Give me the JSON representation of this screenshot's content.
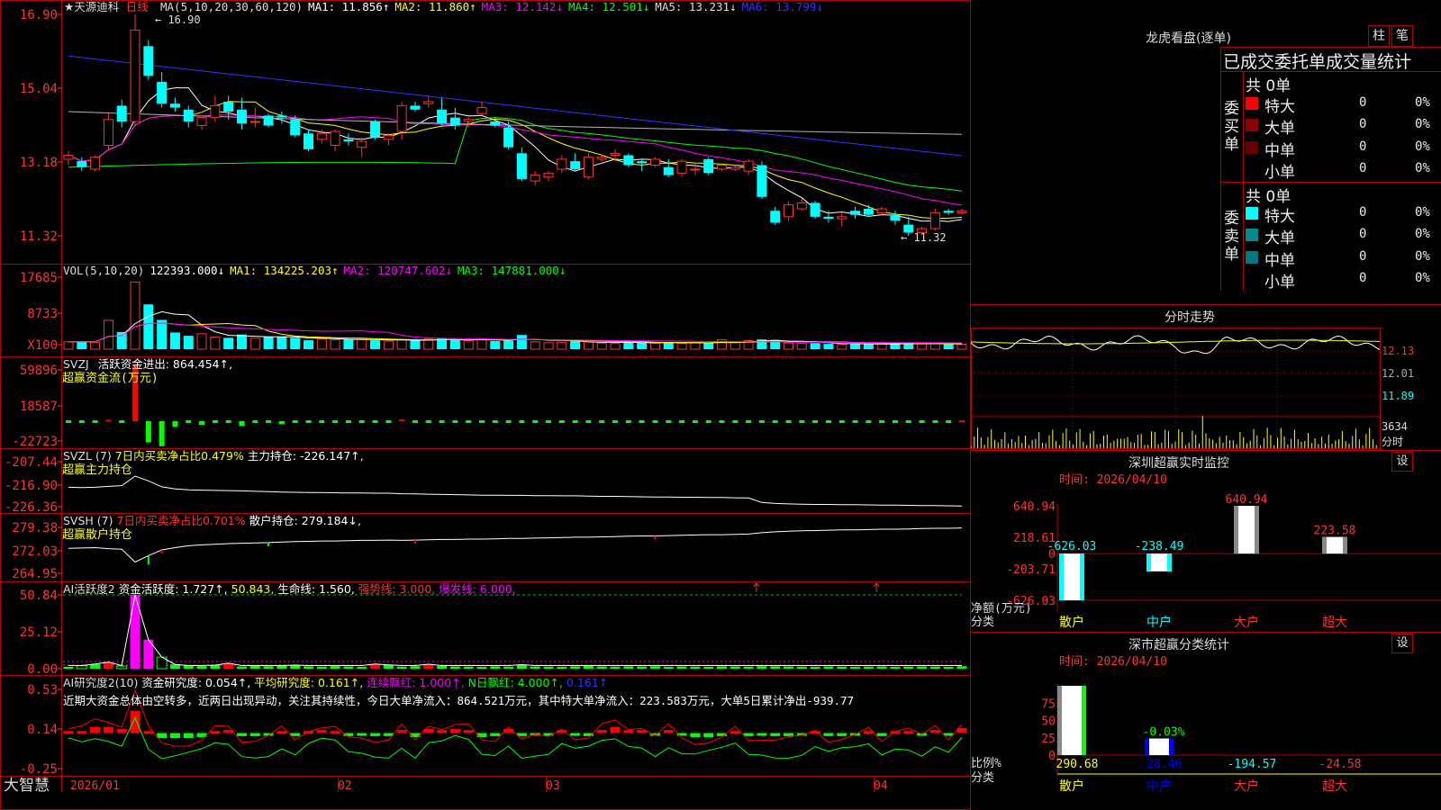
{
  "stock": {
    "name": "★天源迪科",
    "period": "日线"
  },
  "colors": {
    "up": "#ff3232",
    "down": "#00ffff",
    "ma1": "#ffffff",
    "ma2": "#ffff00",
    "ma3": "#ff00ff",
    "ma4": "#00ff00",
    "ma5": "#b4b4b4",
    "ma6": "#3232ff",
    "border": "#b40000"
  },
  "main": {
    "ma_header": [
      {
        "text": "MA(5,10,20,30,60,120)",
        "color": "#dddddd"
      },
      {
        "text": "MA1: 11.856↑",
        "color": "#ffffff"
      },
      {
        "text": "MA2: 11.860↑",
        "color": "#ffff00"
      },
      {
        "text": "MA3: 12.142↓",
        "color": "#ff00ff"
      },
      {
        "text": "MA4: 12.501↓",
        "color": "#00ff00"
      },
      {
        "text": "MA5: 13.231↓",
        "color": "#dddddd"
      },
      {
        "text": "MA6: 13.799↓",
        "color": "#3232ff"
      }
    ],
    "y_ticks": [
      "16.90",
      "15.04",
      "13.18",
      "11.32"
    ],
    "high_label": "16.90",
    "low_label": "11.32",
    "dates": [
      "2026/01",
      "02",
      "03",
      "04"
    ]
  },
  "vol": {
    "header": [
      {
        "text": "VOL(5,10,20)",
        "color": "#dddddd"
      },
      {
        "text": "122393.000↓",
        "color": "#ffffff"
      },
      {
        "text": "MA1: 134225.203↑",
        "color": "#ffff00"
      },
      {
        "text": "MA2: 120747.602↓",
        "color": "#ff00ff"
      },
      {
        "text": "MA3: 147881.000↓",
        "color": "#00ff00"
      }
    ],
    "y_ticks": [
      "17685",
      "8733",
      "X100"
    ]
  },
  "svzj": {
    "header": [
      {
        "text": "SVZJ",
        "color": "#dddddd"
      },
      {
        "text": "活跃资金进出: 864.454↑,",
        "color": "#ffffff"
      }
    ],
    "title2": "超赢资金流(万元)",
    "y_ticks": [
      "59896",
      "18587",
      "-22723"
    ]
  },
  "svzl": {
    "header": [
      {
        "text": "SVZL (7)",
        "color": "#dddddd"
      },
      {
        "text": "7日内买卖净占比0.479%",
        "color": "#ffff00"
      },
      {
        "text": "主力持仓: -226.147↑,",
        "color": "#ffffff"
      }
    ],
    "title2": "超赢主力持仓",
    "y_ticks": [
      "-207.44",
      "-216.90",
      "-226.36"
    ]
  },
  "svsh": {
    "header": [
      {
        "text": "SVSH (7)",
        "color": "#dddddd"
      },
      {
        "text": "7日内买卖净占比0.701%",
        "color": "#ff3232"
      },
      {
        "text": "散户持仓: 279.184↓,",
        "color": "#ffffff"
      }
    ],
    "title2": "超赢散户持仓",
    "y_ticks": [
      "279.38",
      "272.03",
      "264.95"
    ]
  },
  "ai1": {
    "header": [
      {
        "text": "AI活跃度2",
        "color": "#dddddd"
      },
      {
        "text": "资金活跃度: 1.727↑,",
        "color": "#ffffff"
      },
      {
        "text": "50.843,",
        "color": "#ffff00"
      },
      {
        "text": "生命线: 1.560,",
        "color": "#ffffff"
      },
      {
        "text": "强势线: 3.000,",
        "color": "#ff3232"
      },
      {
        "text": "爆发线: 6.000,",
        "color": "#ff00ff"
      }
    ],
    "y_ticks": [
      "50.84",
      "25.12",
      "0.00"
    ]
  },
  "ai2": {
    "header": [
      {
        "text": "AI研究度2(10)",
        "color": "#dddddd"
      },
      {
        "text": "资金研究度: 0.054↑,",
        "color": "#ffffff"
      },
      {
        "text": "平均研究度: 0.161↑,",
        "color": "#ffff00"
      },
      {
        "text": "连续飘红: 1.000↑,",
        "color": "#ff00ff"
      },
      {
        "text": "N日飘红: 4.000↑,",
        "color": "#00ff00"
      },
      {
        "text": "0.161↑",
        "color": "#3232ff"
      }
    ],
    "comment": "近期大资金总体由空转多，近两日出现异动，关注其持续性，今日大单净流入：864.521万元，其中特大单净流入：223.583万元，大单5日累计净出-939.77",
    "y_ticks": [
      "0.53",
      "0.14",
      "-0.25"
    ]
  },
  "brand": "大智慧",
  "right": {
    "lhb_title": "龙虎看盘(逐单)",
    "tabs": [
      "柱",
      "笔"
    ],
    "table_title": "已成交委托单成交量统计",
    "buy": {
      "side_label": "委买单",
      "total": "共 0单",
      "rows": [
        {
          "label": "特大",
          "count": "0",
          "pct": "0%",
          "color": "#ff0000"
        },
        {
          "label": "大单",
          "count": "0",
          "pct": "0%",
          "color": "#8c0000"
        },
        {
          "label": "中单",
          "count": "0",
          "pct": "0%",
          "color": "#640000"
        },
        {
          "label": "小单",
          "count": "0",
          "pct": "0%",
          "color": ""
        }
      ]
    },
    "sell": {
      "side_label": "委卖单",
      "total": "共 0单",
      "rows": [
        {
          "label": "特大",
          "count": "0",
          "pct": "0%",
          "color": "#00ffff"
        },
        {
          "label": "大单",
          "count": "0",
          "pct": "0%",
          "color": "#008c8c"
        },
        {
          "label": "中单",
          "count": "0",
          "pct": "0%",
          "color": "#00787d"
        },
        {
          "label": "小单",
          "count": "0",
          "pct": "0%",
          "color": ""
        }
      ]
    },
    "intraday": {
      "title": "分时走势",
      "y_ticks": [
        "12.13",
        "12.01",
        "11.89"
      ],
      "vol_tick": "3634",
      "vol_label": "分时"
    },
    "monitor": {
      "title": "深圳超赢实时监控",
      "setting": "设",
      "time": "时间: 2026/04/10",
      "y_ticks": [
        "640.94",
        "218.61",
        "0",
        "-203.71",
        "-626.03"
      ],
      "y_label_1": "净额(万元)",
      "y_label_2": "分类"
    },
    "classify": {
      "title": "深市超赢分类统计",
      "setting": "设",
      "time": "时间: 2026/04/10",
      "y_ticks": [
        "75",
        "50",
        "25",
        "0"
      ],
      "y_label_1": "比例%",
      "y_label_2": "分类"
    }
  },
  "chart_data": [
    {
      "type": "candlestick",
      "title": "天源迪科 日线",
      "x_labels": [
        "2026/01",
        "02",
        "03",
        "04"
      ],
      "ylim": [
        11.32,
        16.9
      ],
      "ohlc": [
        [
          13.25,
          13.45,
          13.1,
          13.35
        ],
        [
          13.2,
          13.3,
          12.95,
          13.05
        ],
        [
          13.0,
          13.35,
          12.95,
          13.3
        ],
        [
          13.6,
          14.4,
          13.5,
          14.25
        ],
        [
          14.6,
          14.75,
          14.05,
          14.2
        ],
        [
          14.2,
          16.9,
          14.1,
          16.5
        ],
        [
          16.1,
          16.25,
          15.25,
          15.35
        ],
        [
          15.2,
          15.45,
          14.55,
          14.65
        ],
        [
          14.65,
          14.8,
          14.45,
          14.55
        ],
        [
          14.5,
          14.6,
          14.05,
          14.2
        ],
        [
          14.1,
          14.35,
          14.0,
          14.3
        ],
        [
          14.3,
          14.85,
          14.2,
          14.6
        ],
        [
          14.7,
          14.85,
          14.25,
          14.45
        ],
        [
          14.5,
          14.8,
          14.0,
          14.15
        ],
        [
          14.2,
          14.55,
          14.05,
          14.2
        ],
        [
          14.35,
          14.4,
          14.05,
          14.1
        ],
        [
          14.35,
          14.45,
          14.15,
          14.3
        ],
        [
          14.25,
          14.35,
          13.8,
          13.85
        ],
        [
          13.9,
          14.0,
          13.45,
          13.5
        ],
        [
          13.75,
          14.0,
          13.65,
          13.9
        ],
        [
          13.6,
          14.0,
          13.45,
          13.95
        ],
        [
          13.75,
          13.9,
          13.6,
          13.7
        ],
        [
          13.55,
          13.8,
          13.3,
          13.7
        ],
        [
          14.2,
          14.25,
          13.75,
          13.8
        ],
        [
          13.75,
          13.9,
          13.6,
          13.85
        ],
        [
          13.95,
          14.7,
          13.75,
          14.6
        ],
        [
          14.6,
          14.7,
          14.45,
          14.5
        ],
        [
          14.65,
          14.85,
          14.55,
          14.7
        ],
        [
          14.5,
          14.8,
          14.1,
          14.15
        ],
        [
          14.3,
          14.55,
          14.0,
          14.1
        ],
        [
          14.2,
          14.3,
          14.05,
          14.25
        ],
        [
          14.4,
          14.7,
          14.35,
          14.55
        ],
        [
          14.2,
          14.3,
          14.05,
          14.1
        ],
        [
          14.05,
          14.2,
          13.5,
          13.55
        ],
        [
          13.4,
          13.55,
          12.7,
          12.75
        ],
        [
          12.7,
          12.95,
          12.6,
          12.85
        ],
        [
          12.8,
          12.95,
          12.7,
          12.9
        ],
        [
          13.0,
          13.35,
          12.9,
          13.25
        ],
        [
          13.2,
          13.4,
          12.95,
          13.0
        ],
        [
          12.8,
          13.4,
          12.75,
          13.3
        ],
        [
          13.25,
          13.35,
          13.2,
          13.3
        ],
        [
          13.35,
          13.5,
          13.2,
          13.4
        ],
        [
          13.35,
          13.4,
          13.05,
          13.1
        ],
        [
          13.2,
          13.25,
          12.95,
          13.15
        ],
        [
          13.1,
          13.3,
          13.05,
          13.25
        ],
        [
          13.05,
          13.25,
          12.8,
          12.85
        ],
        [
          12.9,
          13.25,
          12.8,
          13.2
        ],
        [
          13.0,
          13.15,
          12.85,
          13.0
        ],
        [
          13.25,
          13.3,
          12.85,
          12.9
        ],
        [
          13.0,
          13.15,
          12.95,
          13.1
        ],
        [
          13.0,
          13.1,
          12.95,
          13.05
        ],
        [
          12.95,
          13.25,
          12.85,
          13.2
        ],
        [
          13.1,
          13.2,
          12.25,
          12.3
        ],
        [
          11.95,
          12.05,
          11.6,
          11.65
        ],
        [
          11.8,
          12.2,
          11.7,
          12.1
        ],
        [
          12.0,
          12.25,
          11.95,
          12.15
        ],
        [
          12.15,
          12.2,
          11.75,
          11.8
        ],
        [
          11.8,
          11.95,
          11.65,
          11.75
        ],
        [
          11.75,
          11.9,
          11.55,
          11.8
        ],
        [
          11.95,
          12.05,
          11.75,
          11.85
        ],
        [
          12.0,
          12.1,
          11.8,
          11.85
        ],
        [
          11.9,
          12.05,
          11.85,
          12.0
        ],
        [
          11.85,
          11.95,
          11.6,
          11.7
        ],
        [
          11.6,
          11.8,
          11.32,
          11.4
        ],
        [
          11.4,
          11.55,
          11.35,
          11.5
        ],
        [
          11.5,
          12.0,
          11.45,
          11.9
        ],
        [
          11.95,
          12.0,
          11.85,
          11.9
        ],
        [
          11.9,
          12.0,
          11.85,
          11.95
        ]
      ]
    },
    {
      "type": "bar",
      "title": "VOL(5,10,20)",
      "ylim": [
        0,
        17685
      ],
      "values": [
        1800,
        1900,
        1700,
        7100,
        4200,
        16500,
        11000,
        7200,
        4100,
        3300,
        3800,
        3000,
        2800,
        3600,
        2700,
        3000,
        3100,
        2800,
        2200,
        2500,
        2300,
        2400,
        2400,
        2200,
        2000,
        2300,
        2100,
        2500,
        2700,
        2200,
        2100,
        2600,
        2000,
        2100,
        3500,
        1800,
        1600,
        1700,
        2000,
        1800,
        1500,
        1400,
        1800,
        1600,
        1500,
        1700,
        1400,
        1600,
        1500,
        2300,
        1600,
        2100,
        2400,
        2300,
        1500,
        1400,
        1500,
        1300,
        1200,
        1300,
        1200,
        1400,
        1300,
        1500,
        1300,
        1400,
        1200,
        1224
      ]
    },
    {
      "type": "bar",
      "title": "超赢资金流(万元)",
      "ylim": [
        -22723,
        59896
      ],
      "values": [
        0,
        0,
        0,
        1500,
        0,
        59000,
        -22000,
        -26000,
        -6000,
        0,
        -4000,
        0,
        0,
        -5000,
        0,
        0,
        -3000,
        0,
        0,
        0,
        0,
        0,
        0,
        0,
        0,
        1800,
        0,
        0,
        0,
        0,
        0,
        0,
        0,
        0,
        0,
        0,
        0,
        0,
        0,
        0,
        0,
        0,
        0,
        0,
        0,
        0,
        0,
        0,
        0,
        0,
        0,
        0,
        0,
        0,
        0,
        0,
        0,
        0,
        0,
        0,
        0,
        0,
        0,
        0,
        0,
        0,
        0,
        864
      ]
    },
    {
      "type": "line",
      "title": "超赢主力持仓",
      "ylim": [
        -226.36,
        -207.44
      ],
      "values": [
        -218.2,
        -218.3,
        -218.2,
        -217.8,
        -217.5,
        -213.5,
        -215.5,
        -218.0,
        -218.9,
        -219.3,
        -219.4,
        -219.5,
        -219.6,
        -219.7,
        -219.9,
        -220.0,
        -220.2,
        -220.3,
        -220.4,
        -220.4,
        -220.5,
        -220.6,
        -220.6,
        -220.7,
        -220.7,
        -220.9,
        -221.0,
        -221.1,
        -221.2,
        -221.3,
        -221.4,
        -221.5,
        -221.5,
        -221.6,
        -221.6,
        -221.7,
        -221.7,
        -221.8,
        -221.8,
        -221.9,
        -222.0,
        -222.0,
        -222.1,
        -222.2,
        -222.3,
        -222.3,
        -222.4,
        -222.4,
        -222.5,
        -222.5,
        -222.6,
        -222.7,
        -224.6,
        -225.0,
        -225.2,
        -225.3,
        -225.4,
        -225.4,
        -225.5,
        -225.5,
        -225.6,
        -225.7,
        -225.7,
        -225.8,
        -225.9,
        -225.9,
        -226.0,
        -226.1
      ]
    },
    {
      "type": "line",
      "title": "超赢散户持仓",
      "ylim": [
        264.95,
        279.38
      ],
      "values": [
        272.8,
        272.9,
        273.0,
        272.7,
        272.5,
        268.5,
        270.5,
        272.3,
        273.0,
        273.6,
        273.9,
        274.1,
        274.3,
        274.4,
        274.5,
        274.6,
        274.8,
        274.9,
        275.0,
        275.1,
        275.1,
        275.2,
        275.3,
        275.3,
        275.4,
        275.3,
        275.4,
        275.5,
        275.6,
        275.6,
        275.7,
        275.7,
        275.8,
        275.9,
        275.9,
        276.0,
        276.1,
        276.2,
        276.3,
        276.3,
        276.4,
        276.5,
        276.6,
        276.7,
        276.7,
        276.8,
        276.9,
        277.0,
        277.1,
        277.1,
        277.2,
        277.3,
        277.7,
        278.0,
        278.2,
        278.3,
        278.4,
        278.5,
        278.6,
        278.6,
        278.7,
        278.8,
        278.8,
        278.9,
        279.0,
        279.1,
        279.1,
        279.2
      ]
    },
    {
      "type": "bar",
      "title": "AI活跃度2",
      "ylim": [
        0,
        50.84
      ],
      "values": [
        1.3,
        2.0,
        3.2,
        4.5,
        1.8,
        50.8,
        20.0,
        8.0,
        3.0,
        2.2,
        1.8,
        2.5,
        3.8,
        1.5,
        2.1,
        1.7,
        1.9,
        2.5,
        1.6,
        1.4,
        1.8,
        1.5,
        1.3,
        3.2,
        2.6,
        1.4,
        1.7,
        3.1,
        1.9,
        1.5,
        1.4,
        1.3,
        1.6,
        1.4,
        2.8,
        1.5,
        1.4,
        1.3,
        1.6,
        2.0,
        1.5,
        1.4,
        1.6,
        1.5,
        1.7,
        1.3,
        1.5,
        1.4,
        1.3,
        1.6,
        1.5,
        1.4,
        1.7,
        1.6,
        1.5,
        1.4,
        1.3,
        1.5,
        1.4,
        1.3,
        1.4,
        1.5,
        1.3,
        1.4,
        1.5,
        1.4,
        1.3,
        1.7
      ]
    },
    {
      "type": "bar",
      "title": "AI研究度2(10)",
      "ylim": [
        -0.25,
        0.53
      ],
      "values": [
        0.02,
        0.02,
        0.06,
        0.06,
        0.04,
        0.22,
        0.02,
        -0.05,
        -0.05,
        -0.05,
        -0.04,
        0.02,
        0.03,
        -0.03,
        -0.03,
        -0.02,
        0.02,
        -0.03,
        0.02,
        0.03,
        0.02,
        -0.03,
        -0.02,
        -0.03,
        -0.03,
        0.03,
        -0.04,
        0.04,
        0.03,
        0.04,
        0.03,
        -0.04,
        -0.03,
        0.04,
        -0.03,
        -0.02,
        -0.02,
        0.03,
        -0.02,
        -0.03,
        0.03,
        0.06,
        0.03,
        0.03,
        -0.02,
        0.03,
        -0.02,
        -0.04,
        -0.04,
        -0.03,
        0.02,
        -0.03,
        -0.02,
        -0.03,
        -0.03,
        -0.02,
        0.02,
        -0.03,
        -0.03,
        -0.02,
        0.02,
        -0.03,
        0.02,
        0.02,
        -0.02,
        0.03,
        -0.02,
        0.05
      ]
    },
    {
      "type": "bar",
      "title": "深圳超赢实时监控",
      "categories": [
        "散户",
        "中户",
        "大户",
        "超大"
      ],
      "values": [
        -626.03,
        -238.49,
        640.94,
        223.58
      ],
      "ylim": [
        -626.03,
        640.94
      ]
    },
    {
      "type": "bar",
      "title": "深市超赢分类统计",
      "categories": [
        "散户",
        "中户",
        "大户",
        "超大"
      ],
      "values": [
        290.68,
        28.46,
        -194.57,
        -24.58
      ],
      "bar_percent": [
        100,
        24,
        0,
        0
      ],
      "mid_label": "-0.03%"
    }
  ]
}
